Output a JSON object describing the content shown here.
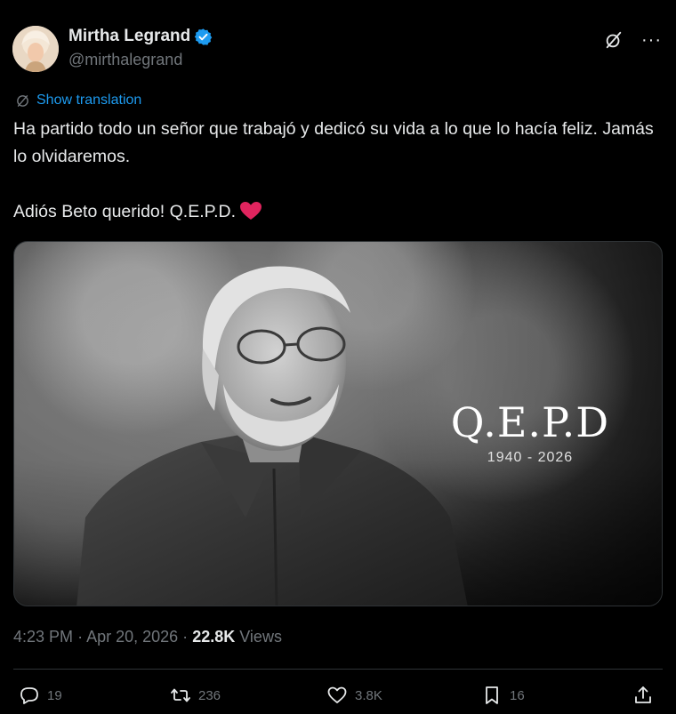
{
  "author": {
    "display_name": "Mirtha Legrand",
    "handle": "@mirthalegrand",
    "verified": true,
    "verified_color": "#1d9bf0"
  },
  "top_actions": {
    "grok_icon": "grok-slash-icon",
    "more_icon": "more-horizontal-icon",
    "more_glyph": "···"
  },
  "translation": {
    "label": "Show translation",
    "icon": "translate-globe-icon",
    "color": "#1d9bf0"
  },
  "body": {
    "line1": "Ha partido todo un señor que trabajó y dedicó su vida a lo que lo hacía feliz. Jamás lo olvidaremos.",
    "line2": "Adiós Beto querido! Q.E.P.D.",
    "emoji": "red-heart-emoji"
  },
  "media": {
    "overlay_title": "Q.E.P.D",
    "overlay_years": "1940 - 2026"
  },
  "meta": {
    "time": "4:23 PM",
    "separator1": "·",
    "date": "Apr 20, 2026",
    "separator2": "·",
    "views_count": "22.8K",
    "views_label": "Views"
  },
  "actions": {
    "replies": "19",
    "reposts": "236",
    "likes": "3.8K",
    "bookmarks": "16"
  },
  "colors": {
    "background": "#000000",
    "primary_text": "#e7e9ea",
    "secondary_text": "#71767b",
    "accent": "#1d9bf0",
    "divider": "#2f3336",
    "heart": "#e0245e"
  }
}
